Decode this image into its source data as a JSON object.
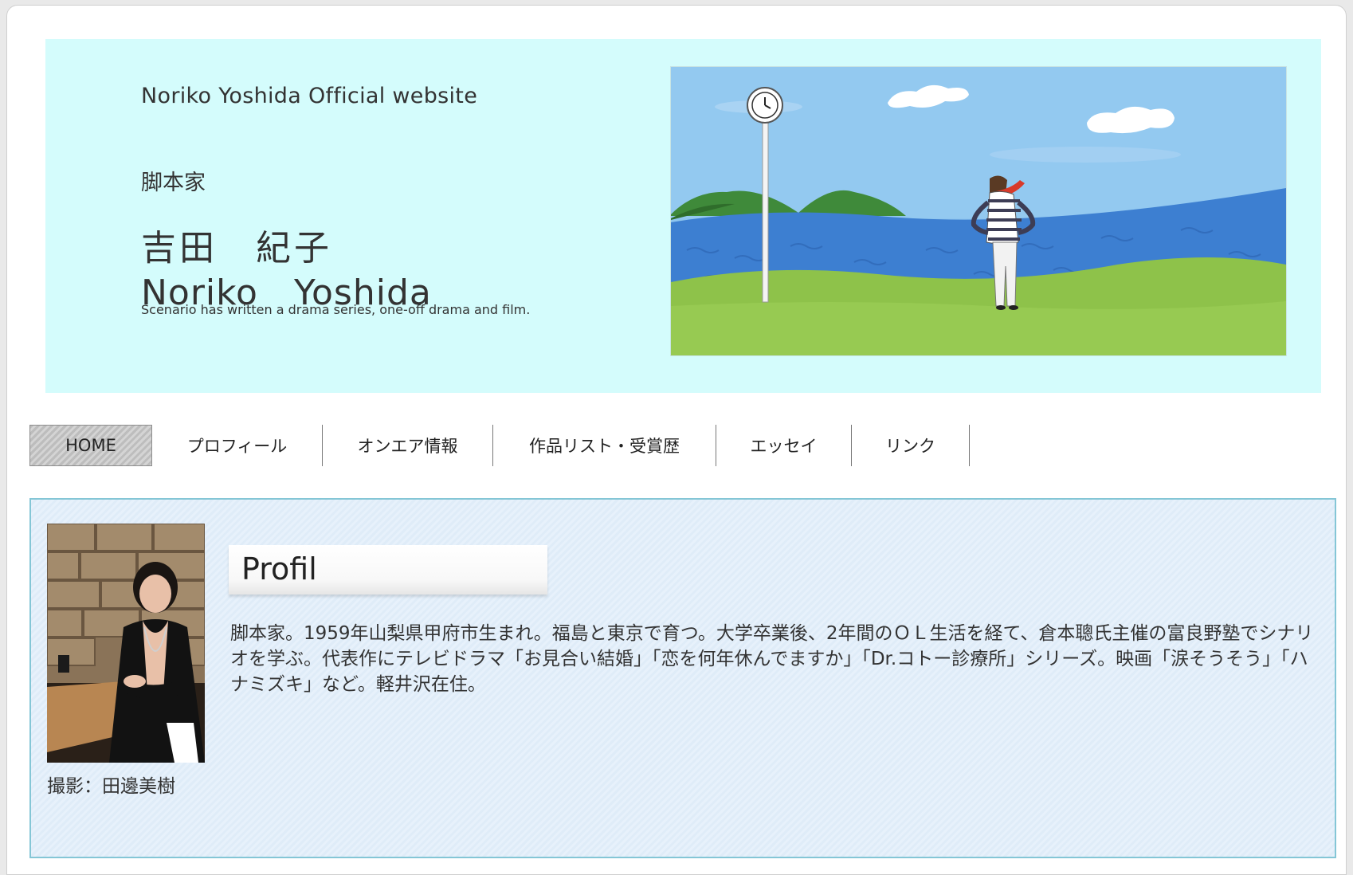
{
  "header": {
    "site_subtitle": "Noriko Yoshida Official website",
    "role": "脚本家",
    "name_jp": "吉田　紀子",
    "name_en": "Noriko　Yoshida",
    "tagline": "Scenario has written a drama series, one-off drama and film."
  },
  "nav": {
    "items": [
      {
        "label": "HOME"
      },
      {
        "label": "プロフィール"
      },
      {
        "label": "オンエア情報"
      },
      {
        "label": "作品リスト・受賞歴"
      },
      {
        "label": "エッセイ"
      },
      {
        "label": "リンク"
      }
    ],
    "active_index": 0
  },
  "profile": {
    "heading": "Profil",
    "photo_caption": "撮影：田邊美樹",
    "bio": "脚本家。1959年山梨県甲府市生まれ。福島と東京で育つ。大学卒業後、2年間のＯＬ生活を経て、倉本聰氏主催の富良野塾でシナリオを学ぶ。代表作にテレビドラマ「お見合い結婚」「恋を何年休んでますか」「Dr.コトー診療所」シリーズ。映画「涙そうそう」「ハナミズキ」など。軽井沢在住。"
  },
  "colors": {
    "header_bg": "#d4fcfc",
    "content_bg": "#e4effa",
    "content_border": "#84c6d6"
  }
}
